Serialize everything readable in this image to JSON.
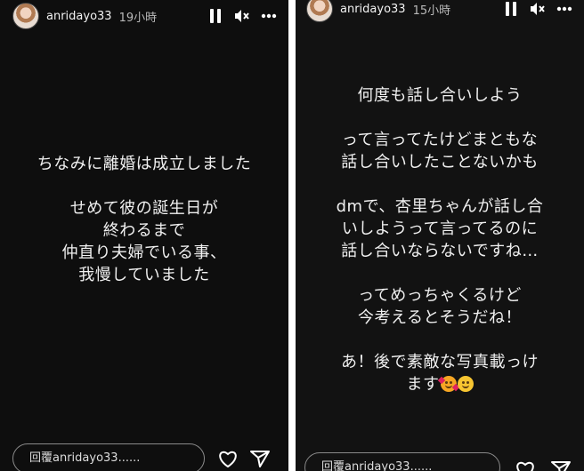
{
  "stories": [
    {
      "username": "anridayo33",
      "time": "19小時",
      "text_blocks": [
        [
          "ちなみに離婚は成立しました"
        ],
        [
          "せめて彼の誕生日が",
          "終わるまで",
          "仲直り夫婦でいる事、",
          "我慢していました"
        ]
      ],
      "reply_placeholder": "回覆anridayo33......",
      "icons": {
        "pause": "pause-icon",
        "mute": "mute-icon",
        "more": "more-icon",
        "like": "heart-icon",
        "send": "send-icon"
      }
    },
    {
      "username": "anridayo33",
      "time": "15小時",
      "text_blocks": [
        [
          "何度も話し合いしよう"
        ],
        [
          "って言ってたけどまともな",
          "話し合いしたことないかも"
        ],
        [
          "dmで、杏里ちゃんが話し合",
          "いしようって言ってるのに",
          "話し合いならないですね…"
        ],
        [
          "ってめっちゃくるけど",
          "今考えるとそうだね！"
        ],
        [
          "あ！後で素敵な写真載っけ",
          "ます"
        ]
      ],
      "trailing_emojis": [
        "smiling-face-with-hearts",
        "smiling-face"
      ],
      "reply_placeholder": "回覆anridayo33......",
      "icons": {
        "pause": "pause-icon",
        "mute": "mute-icon",
        "more": "more-icon",
        "like": "heart-icon",
        "send": "send-icon"
      }
    }
  ],
  "colors": {
    "background": "#0e0e0e",
    "text": "#f0f0f0",
    "border": "#8a8a8a"
  }
}
